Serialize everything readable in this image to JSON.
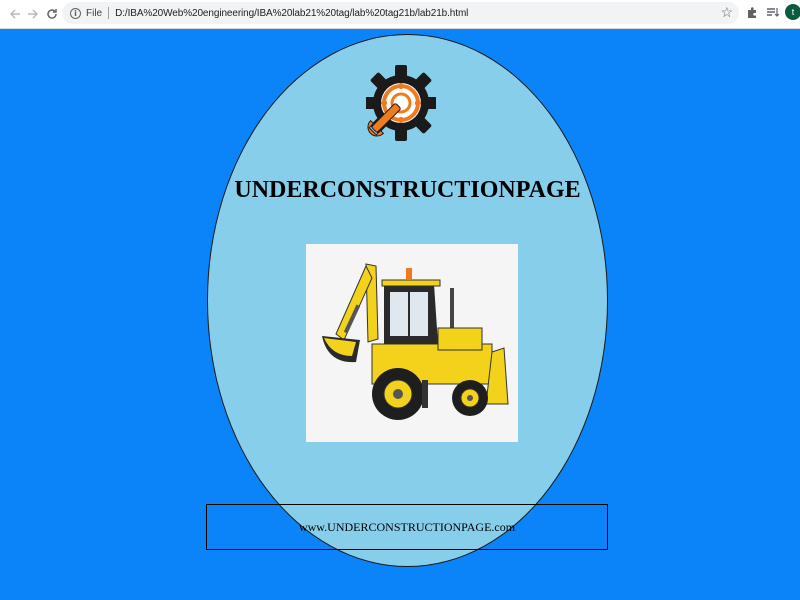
{
  "browser": {
    "scheme_label": "File",
    "url": "D:/IBA%20Web%20engineering/IBA%20lab21%20tag/lab%20tag21b/lab21b.html",
    "avatar_letter": "t",
    "icons": [
      "back-arrow-icon",
      "forward-arrow-icon",
      "reload-icon",
      "info-icon",
      "star-icon",
      "puzzle-icon",
      "reading-list-icon"
    ]
  },
  "page": {
    "background_color": "#0a84f8",
    "ellipse_color": "#87ceeb",
    "logo_icon": "gear-wrench-icon",
    "logo_colors": {
      "gear": "#1a1a1a",
      "accent": "#f07b1d"
    },
    "heading": "UNDERCONSTRUCTIONPAGE",
    "image_subject": "backhoe-loader",
    "footer_text": "www.UNDERCONSTRUCTIONPAGE.com"
  }
}
